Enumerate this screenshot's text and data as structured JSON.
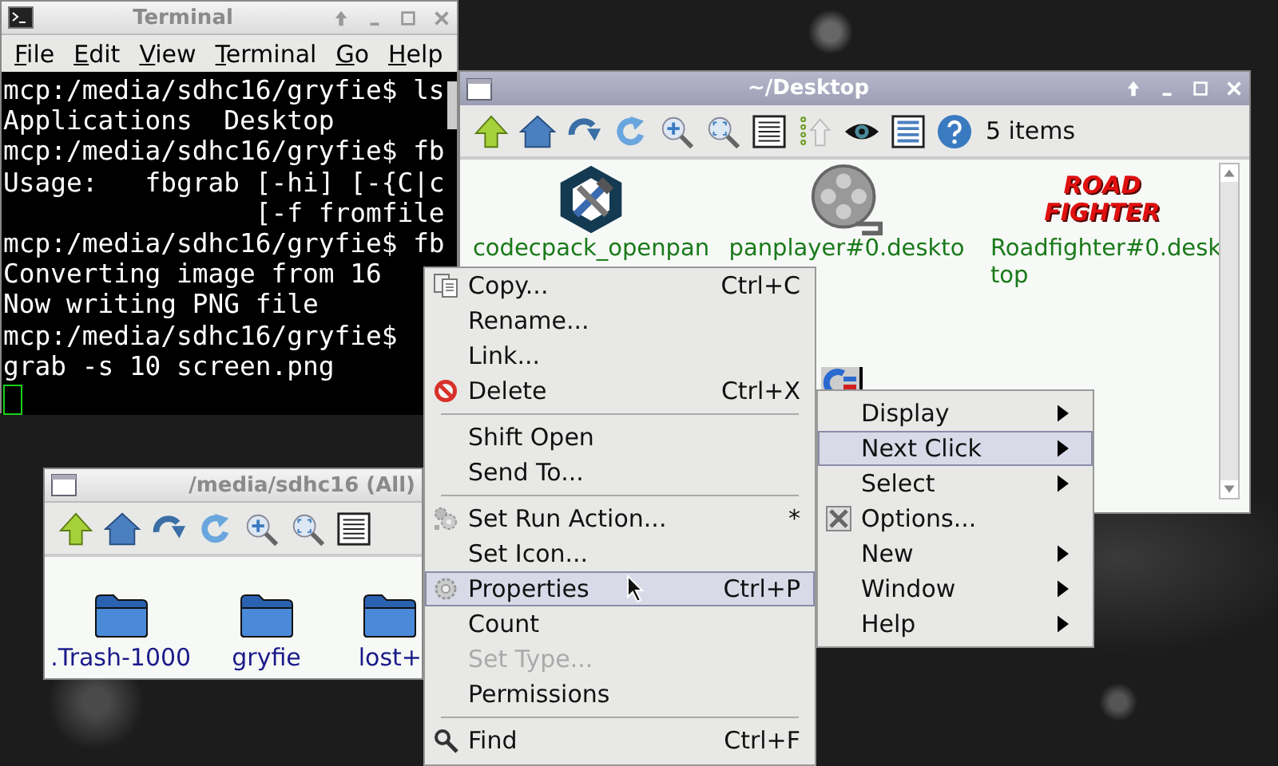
{
  "terminal": {
    "title": "Terminal",
    "menu": [
      "File",
      "Edit",
      "View",
      "Terminal",
      "Go",
      "Help"
    ],
    "lines": [
      "mcp:/media/sdhc16/gryfie$ ls",
      "Applications  Desktop",
      "mcp:/media/sdhc16/gryfie$ fb",
      "Usage:   fbgrab [-hi] [-{C|c",
      "                [-f fromfile",
      "mcp:/media/sdhc16/gryfie$ fb",
      "Converting image from 16",
      "Now writing PNG file",
      "mcp:/media/sdhc16/gryfie$",
      "grab -s 10 screen.png"
    ]
  },
  "desktop_window": {
    "title": "~/Desktop",
    "item_count": "5 items",
    "items": [
      {
        "label_lines": [
          "codecpack_openpan"
        ]
      },
      {
        "label_lines": [
          "panplayer#0.deskto"
        ]
      },
      {
        "label_lines": [
          "Roadfighter#0.desk",
          "top"
        ],
        "logo_text": [
          "ROAD",
          "FIGHTER"
        ]
      }
    ]
  },
  "media_window": {
    "title": "/media/sdhc16 (All)",
    "items": [
      {
        "label": ".Trash-1000"
      },
      {
        "label": "gryfie"
      },
      {
        "label": "lost+"
      }
    ]
  },
  "context_menu": {
    "items": [
      {
        "kind": "item",
        "label": "Copy...",
        "shortcut": "Ctrl+C",
        "selected": false,
        "disabled": false
      },
      {
        "kind": "item",
        "label": "Rename...",
        "selected": false,
        "disabled": false
      },
      {
        "kind": "item",
        "label": "Link...",
        "selected": false,
        "disabled": false
      },
      {
        "kind": "item",
        "label": "Delete",
        "shortcut": "Ctrl+X",
        "selected": false,
        "disabled": false
      },
      {
        "kind": "separator"
      },
      {
        "kind": "item",
        "label": "Shift Open",
        "selected": false,
        "disabled": false
      },
      {
        "kind": "item",
        "label": "Send To...",
        "selected": false,
        "disabled": false
      },
      {
        "kind": "separator"
      },
      {
        "kind": "item",
        "label": "Set Run Action...",
        "shortcut": "*",
        "selected": false,
        "disabled": false
      },
      {
        "kind": "item",
        "label": "Set Icon...",
        "selected": false,
        "disabled": false
      },
      {
        "kind": "item",
        "label": "Properties",
        "shortcut": "Ctrl+P",
        "selected": true,
        "disabled": false
      },
      {
        "kind": "item",
        "label": "Count",
        "selected": false,
        "disabled": false
      },
      {
        "kind": "item",
        "label": "Set Type...",
        "selected": false,
        "disabled": true
      },
      {
        "kind": "item",
        "label": "Permissions",
        "selected": false,
        "disabled": false
      },
      {
        "kind": "separator"
      },
      {
        "kind": "item",
        "label": "Find",
        "shortcut": "Ctrl+F",
        "selected": false,
        "disabled": false
      }
    ]
  },
  "submenu": {
    "items": [
      {
        "label": "Display",
        "has_submenu": true,
        "selected": false
      },
      {
        "label": "Next Click",
        "has_submenu": true,
        "selected": true
      },
      {
        "label": "Select",
        "has_submenu": true,
        "selected": false
      },
      {
        "label": "Options...",
        "has_submenu": false,
        "selected": false
      },
      {
        "label": "New",
        "has_submenu": true,
        "selected": false
      },
      {
        "label": "Window",
        "has_submenu": true,
        "selected": false
      },
      {
        "label": "Help",
        "has_submenu": true,
        "selected": false
      }
    ]
  }
}
